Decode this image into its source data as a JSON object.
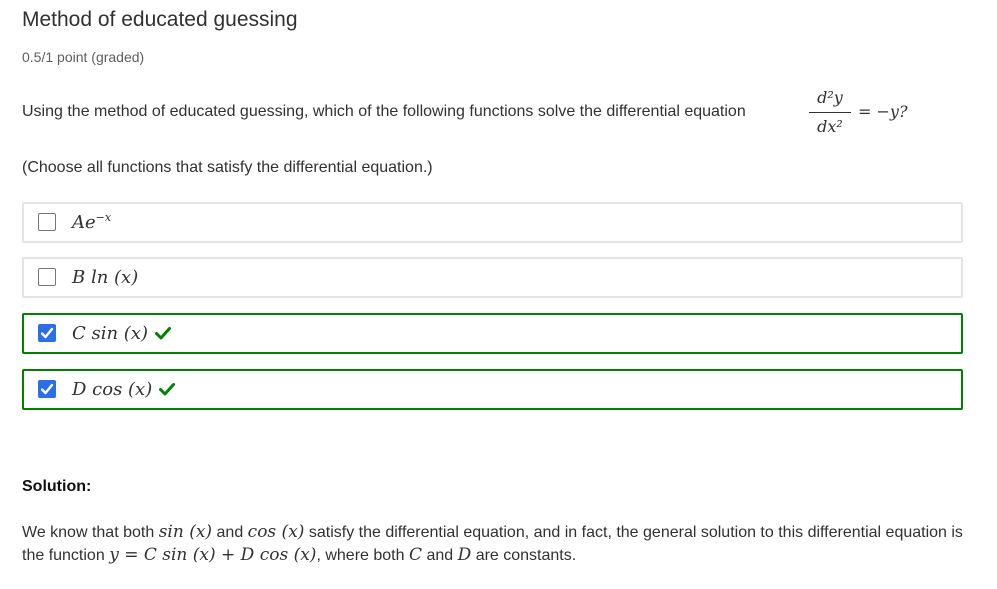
{
  "problem": {
    "title": "Method of educated guessing",
    "points": "0.5/1 point (graded)"
  },
  "question": {
    "text": "Using the method of educated guessing, which of the following functions solve the differential equation",
    "equation": {
      "numerator": "d²y",
      "denominator": "dx²",
      "rhs": "= −y?"
    },
    "instruction": "(Choose all functions that satisfy the differential equation.)"
  },
  "choices": [
    {
      "label": "Ae",
      "sup": "−x",
      "checked": false,
      "correct": false
    },
    {
      "label": "B ln (x)",
      "checked": false,
      "correct": false
    },
    {
      "label": "C sin (x)",
      "checked": true,
      "correct": true
    },
    {
      "label": "D cos (x)",
      "checked": true,
      "correct": true
    }
  ],
  "solution": {
    "heading": "Solution:",
    "segments": [
      "We know that both",
      "sin (x)",
      "and",
      "cos (x)",
      "satisfy the differential equation, and in fact, the general solution to this differential equation is the function",
      "y = C sin (x) + D cos (x)",
      ", where both",
      "C",
      "and",
      "D",
      "are constants."
    ]
  },
  "colors": {
    "checkbox_checked": "#2a6ee8",
    "correct_border": "#008100",
    "correct_tick": "#008100",
    "default_border": "#e4e4e4"
  },
  "icons": {
    "checkbox_mark": "checkmark-icon",
    "correct_indicator": "correct-check-icon"
  }
}
